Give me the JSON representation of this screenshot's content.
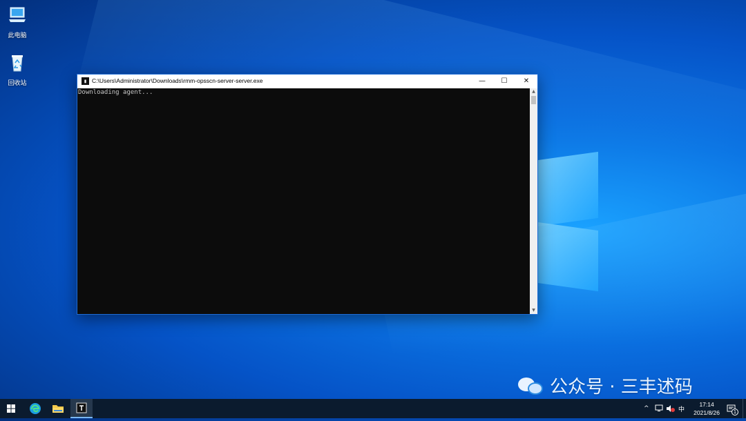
{
  "desktop": {
    "icons": [
      {
        "label": "此电脑",
        "icon": "computer-icon"
      },
      {
        "label": "回收站",
        "icon": "recycle-bin-icon"
      }
    ],
    "watermark": {
      "text": "公众号 · 三丰述码",
      "icon": "wechat-icon"
    }
  },
  "window": {
    "title": "C:\\Users\\Administrator\\Downloads\\rmm-opsscn-server-server.exe",
    "controls": {
      "minimize": "—",
      "maximize": "☐",
      "close": "✕"
    },
    "console_output": "Downloading agent..."
  },
  "taskbar": {
    "apps": [
      {
        "name": "start",
        "icon": "windows-icon"
      },
      {
        "name": "edge",
        "icon": "edge-icon"
      },
      {
        "name": "explorer",
        "icon": "folder-icon"
      },
      {
        "name": "console",
        "icon": "console-icon",
        "active": true
      }
    ],
    "tray": {
      "chevron": "^",
      "ime": "中",
      "time": "17:14",
      "date": "2021/8/26",
      "notification_count": "1"
    }
  },
  "colors": {
    "accent": "#0a6fe0",
    "console_bg": "#0c0c0c",
    "taskbar_bg": "#0b1b2e"
  }
}
